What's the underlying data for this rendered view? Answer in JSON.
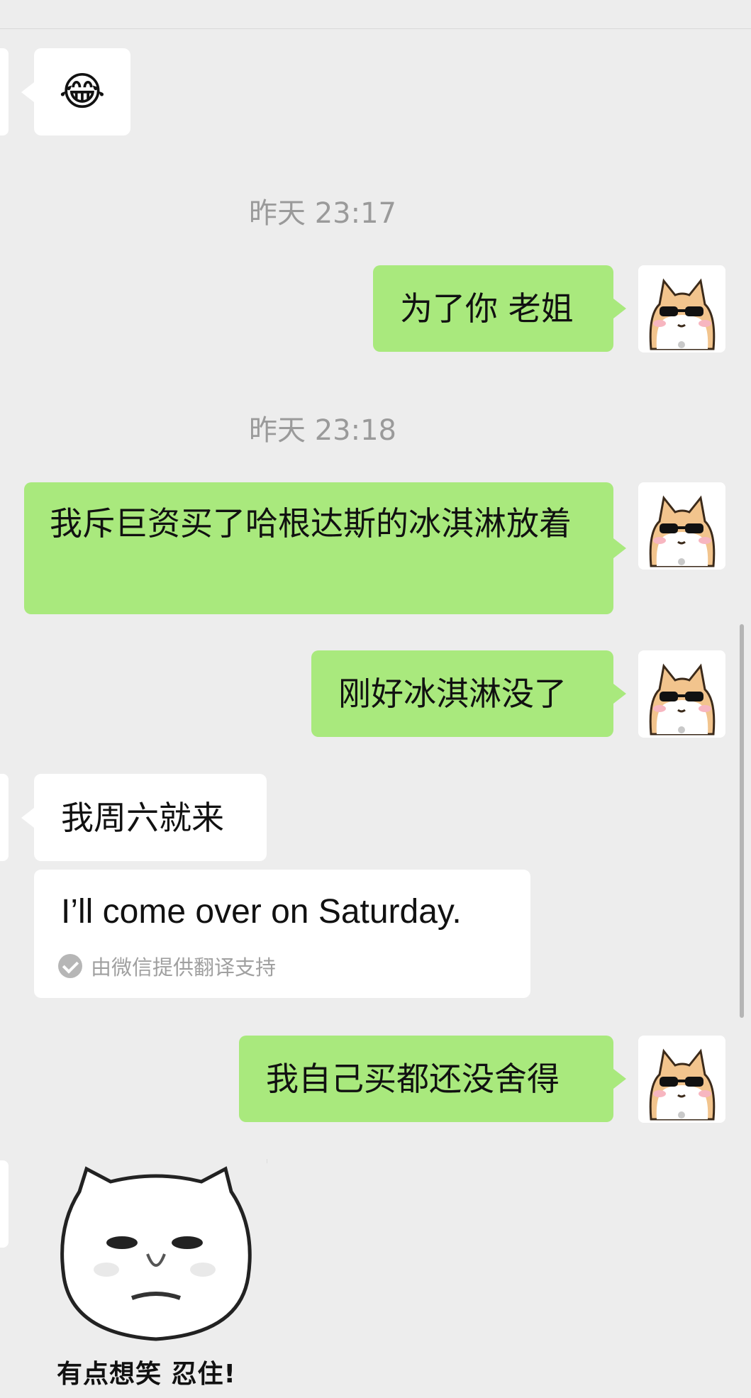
{
  "timestamps": [
    "昨天 23:17",
    "昨天 23:18"
  ],
  "messages": {
    "m0_emoji": "😂",
    "m1": "为了你 老姐",
    "m2": "我斥巨资买了哈根达斯的冰淇淋放着",
    "m3": "刚好冰淇淋没了",
    "m4": "我周六就来",
    "m5": "我自己买都还没舍得"
  },
  "translation": {
    "text": "I’ll come over on Saturday.",
    "note": "由微信提供翻译支持"
  },
  "sticker": {
    "caption": "有点想笑  忍住!"
  },
  "colors": {
    "background": "#ededed",
    "sent_bubble": "#a9e97d",
    "received_bubble": "#ffffff",
    "timestamp": "#9a9a9a"
  },
  "icons": {
    "avatar": "cat-with-sunglasses-avatar",
    "verified": "check-circle-icon"
  }
}
